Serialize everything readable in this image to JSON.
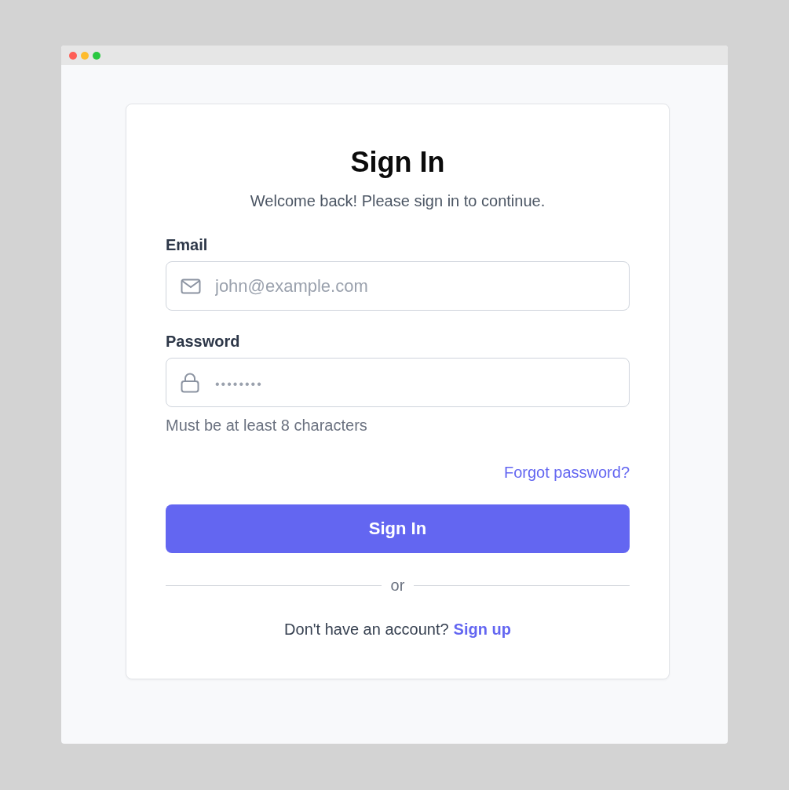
{
  "title": "Sign In",
  "subtitle": "Welcome back! Please sign in to continue.",
  "fields": [
    {
      "kind": "email",
      "label": "Email",
      "placeholder": "john@example.com"
    },
    {
      "kind": "password",
      "label": "Password",
      "placeholder": "••••••••",
      "hint": "Must be at least 8 characters"
    }
  ],
  "forgot_link": "Forgot password?",
  "submit_button": "Sign In",
  "divider": "or",
  "footer": {
    "text": "Don't have an account?",
    "link": "Sign up"
  }
}
